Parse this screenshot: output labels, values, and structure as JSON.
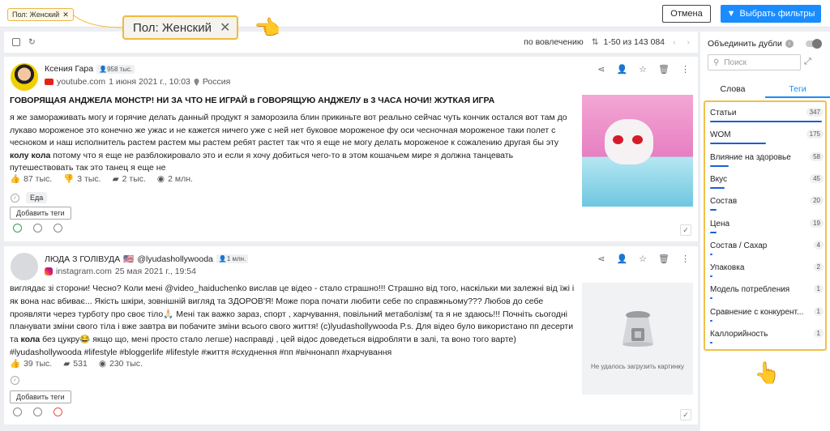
{
  "header": {
    "filter_chip": "Пол: Женский",
    "callout_label": "Пол: Женский",
    "cancel_label": "Отмена",
    "apply_label": "Выбрать фильтры"
  },
  "list": {
    "sort_label": "по вовлечению",
    "range_label": "1-50 из 143 084"
  },
  "posts": [
    {
      "author": "Ксения Гара",
      "followers": "958 тыс.",
      "source": "youtube.com",
      "date": "1 июня 2021 г., 10:03",
      "location": "Россия",
      "title": "ГОВОРЯЩАЯ АНДЖЕЛА МОНСТР! НИ ЗА ЧТО НЕ ИГРАЙ в ГОВОРЯЩУЮ АНДЖЕЛУ в 3 ЧАСА НОЧИ! ЖУТКАЯ ИГРА",
      "text_before": "я же замораживать могу и горячие делать данный продукт я заморозила блин прикиньте вот реально сейчас чуть кончик остался вот там до лукаво мороженое это конечно же ужас и не кажется ничего уже с ней нет буковое мороженое фу оси чесночная мороженое таки полет с чесноком и наш исполнитель растем растем мы растем ребят растет так что я еще не могу делать мороженое к сожалению другая бы эту ",
      "text_bold": "колу кола",
      "text_after": " потому что я еще не разблокировало это и если я хочу добиться чего-то в этом кошачьем мире я должна танцевать путешествовать так это танец я еще не",
      "likes": "87 тыс.",
      "dislikes": "3 тыс.",
      "comments": "2 тыс.",
      "views": "2 млн.",
      "tag": "Еда",
      "add_tags_label": "Добавить теги"
    },
    {
      "author": "ЛЮДА З ГОЛІВУДА",
      "flag": "🇺🇸",
      "handle": "@lyudashollywooda",
      "followers": "1 млн.",
      "source": "instagram.com",
      "date": "25 мая 2021 г., 19:54",
      "text_before": "виглядає зі сторони! Чесно? Коли мені @video_haiduchenko вислав це відео - стало страшно!!! Страшно від того, наскільки ми залежні від їжі і як вона нас вбиває... Якість шкіри, зовнішній вигляд та ЗДОРОВ'Я! Може пора почати любити себе по справжньому??? Любов до себе проявляти через турботу про своє тіло🙏🏻 Мені так важко зараз, спорт , харчування, повільний метаболізм( та я не здаюсь!!! Почніть сьогодні планувати зміни свого тіла і вже завтра ви побачите зміни всього свого життя! (с)lyudashollywooda P.s. Для відео було використано пп десерти та ",
      "text_bold": "кола",
      "text_after": " без цукру😂 якщо що, мені просто стало легше) насправді , цей відос доведеться відробляти в залі, та воно того варте) #lyudashollywooda #lifestyle #bloggerlife #lifestyle #життя #схуднення #пп #вічнонапп #харчування",
      "likes": "39 тыс.",
      "comments": "531",
      "views": "230 тыс.",
      "no_image_label": "Не удалось загрузить картинку",
      "add_tags_label": "Добавить теги"
    }
  ],
  "sidebar": {
    "merge_label": "Объединить дубли",
    "search_placeholder": "Поиск",
    "tab_words": "Слова",
    "tab_tags": "Теги",
    "tags": [
      {
        "label": "Статьи",
        "count": "347",
        "fraction": 1.0
      },
      {
        "label": "WOM",
        "count": "175",
        "fraction": 0.5
      },
      {
        "label": "Влияние на здоровье",
        "count": "58",
        "fraction": 0.17
      },
      {
        "label": "Вкус",
        "count": "45",
        "fraction": 0.13
      },
      {
        "label": "Состав",
        "count": "20",
        "fraction": 0.06
      },
      {
        "label": "Цена",
        "count": "19",
        "fraction": 0.055
      },
      {
        "label": "Состав / Сахар",
        "count": "4",
        "fraction": 0.012
      },
      {
        "label": "Упаковка",
        "count": "2",
        "fraction": 0.006
      },
      {
        "label": "Модель потребления",
        "count": "1",
        "fraction": 0.003
      },
      {
        "label": "Сравнение с конкурент...",
        "count": "1",
        "fraction": 0.003
      },
      {
        "label": "Каллорийность",
        "count": "1",
        "fraction": 0.003
      }
    ]
  },
  "colors": {
    "accent": "#1a8cff",
    "highlight": "#f0c14b",
    "bar": "#1a5fd6"
  }
}
